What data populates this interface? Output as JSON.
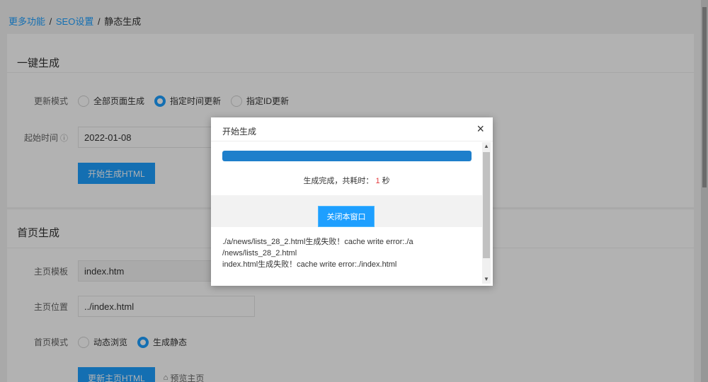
{
  "breadcrumb": {
    "item1": "更多功能",
    "item2": "SEO设置",
    "current": "静态生成",
    "sep": "/"
  },
  "section_onekey": {
    "title": "一键生成",
    "update_mode_label": "更新模式",
    "modes": [
      "全部页面生成",
      "指定时间更新",
      "指定ID更新"
    ],
    "selected_mode": "指定时间更新",
    "start_time_label": "起始时间",
    "start_time_help_icon": "ⓘ",
    "start_time_value": "2022-01-08",
    "generate_button": "开始生成HTML"
  },
  "section_home": {
    "title": "首页生成",
    "template_label": "主页模板",
    "template_value": "index.htm",
    "location_label": "主页位置",
    "location_value": "../index.html",
    "mode_label": "首页模式",
    "modes": [
      "动态浏览",
      "生成静态"
    ],
    "selected_mode": "生成静态",
    "update_button": "更新主页HTML",
    "preview_link": "预览主页",
    "preview_icon": "home-icon"
  },
  "modal": {
    "title": "开始生成",
    "close_glyph": "×",
    "progress_percent": 100,
    "progress_color": "#1e7fcb",
    "done_prefix": "生成完成，共耗时：",
    "done_seconds": "1",
    "done_suffix": "秒",
    "close_window_button": "关闭本窗口",
    "log_lines": [
      "./a/news/lists_28_2.html生成失败！cache write error:./a",
      "/news/lists_28_2.html",
      "index.html生成失败！cache write error:./index.html"
    ]
  },
  "colors": {
    "accent": "#1e9fff",
    "highlight_number": "#e4393c"
  }
}
